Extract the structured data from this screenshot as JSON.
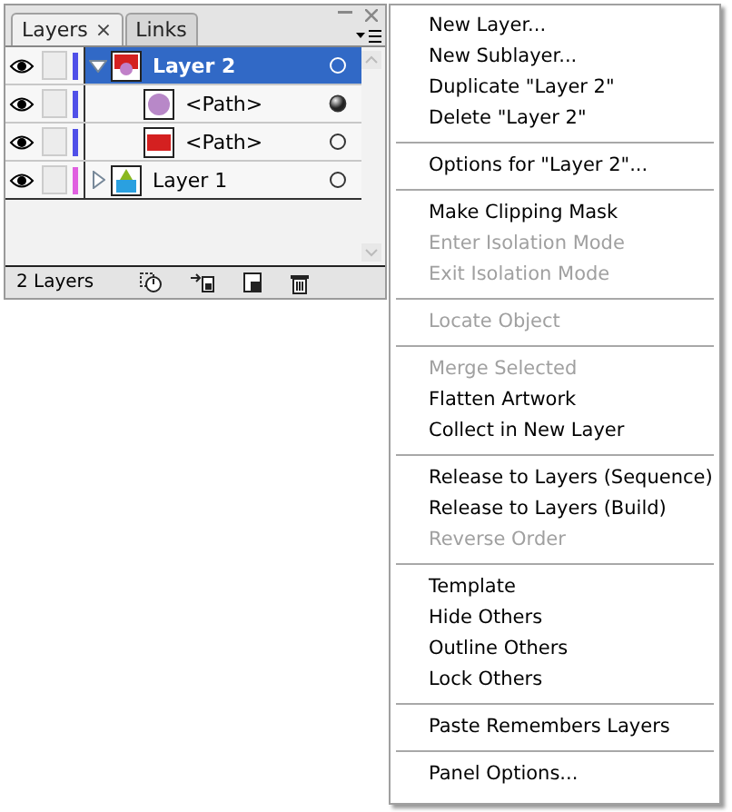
{
  "panel": {
    "tabs": [
      {
        "label": "Layers",
        "close": "×",
        "selected": true
      },
      {
        "label": "Links",
        "selected": false
      }
    ],
    "layers": [
      {
        "name": "Layer 2",
        "selected": true,
        "expanded": true,
        "visible": true,
        "color": "#5050e8",
        "kind": "layer2",
        "has_appearance": false,
        "children": [
          {
            "name": "<Path>",
            "visible": true,
            "color": "#5050e8",
            "kind": "circle",
            "has_appearance": true,
            "selected": false
          },
          {
            "name": "<Path>",
            "visible": true,
            "color": "#5050e8",
            "kind": "rect",
            "has_appearance": false,
            "selected": false
          }
        ]
      },
      {
        "name": "Layer 1",
        "selected": false,
        "expanded": false,
        "visible": true,
        "color": "#e060e0",
        "kind": "layer1",
        "has_appearance": false
      }
    ],
    "status": "2 Layers"
  },
  "menu": {
    "groups": [
      [
        {
          "text": "New Layer...",
          "disabled": false
        },
        {
          "text": "New Sublayer...",
          "disabled": false
        },
        {
          "text": "Duplicate \"Layer 2\"",
          "disabled": false
        },
        {
          "text": "Delete \"Layer 2\"",
          "disabled": false
        }
      ],
      [
        {
          "text": "Options for \"Layer 2\"...",
          "disabled": false
        }
      ],
      [
        {
          "text": "Make Clipping Mask",
          "disabled": false
        },
        {
          "text": "Enter Isolation Mode",
          "disabled": true
        },
        {
          "text": "Exit Isolation Mode",
          "disabled": true
        }
      ],
      [
        {
          "text": "Locate Object",
          "disabled": true
        }
      ],
      [
        {
          "text": "Merge Selected",
          "disabled": true
        },
        {
          "text": "Flatten Artwork",
          "disabled": false
        },
        {
          "text": "Collect in New Layer",
          "disabled": false
        }
      ],
      [
        {
          "text": "Release to Layers (Sequence)",
          "disabled": false
        },
        {
          "text": "Release to Layers (Build)",
          "disabled": false
        },
        {
          "text": "Reverse Order",
          "disabled": true
        }
      ],
      [
        {
          "text": "Template",
          "disabled": false
        },
        {
          "text": "Hide Others",
          "disabled": false
        },
        {
          "text": "Outline Others",
          "disabled": false
        },
        {
          "text": "Lock Others",
          "disabled": false
        }
      ],
      [
        {
          "text": "Paste Remembers Layers",
          "disabled": false
        }
      ],
      [
        {
          "text": "Panel Options...",
          "disabled": false
        }
      ]
    ]
  }
}
